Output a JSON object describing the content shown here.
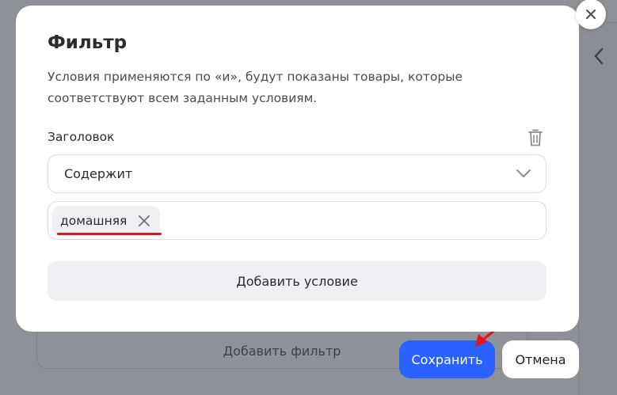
{
  "modal": {
    "title": "Фильтр",
    "description": "Условия применяются по «и», будут показаны товары, которые соответствуют всем заданным условиям.",
    "field_label": "Заголовок",
    "condition_select": {
      "value": "Содержит"
    },
    "tags": [
      {
        "label": "домашняя"
      }
    ],
    "add_condition_label": "Добавить условие"
  },
  "background": {
    "add_filter_label": "Добавить фильтр",
    "save_label": "Сохранить",
    "cancel_label": "Отмена"
  },
  "icons": {
    "close": "close-icon",
    "trash": "trash-icon",
    "chevron_down": "chevron-down-icon",
    "tag_remove": "close-icon",
    "panel_chevron": "chevron-left-icon"
  },
  "colors": {
    "primary": "#2962ff",
    "highlight_underline": "#e8121e",
    "annotation_arrow": "#e8121e",
    "overlay": "#8d9096"
  }
}
